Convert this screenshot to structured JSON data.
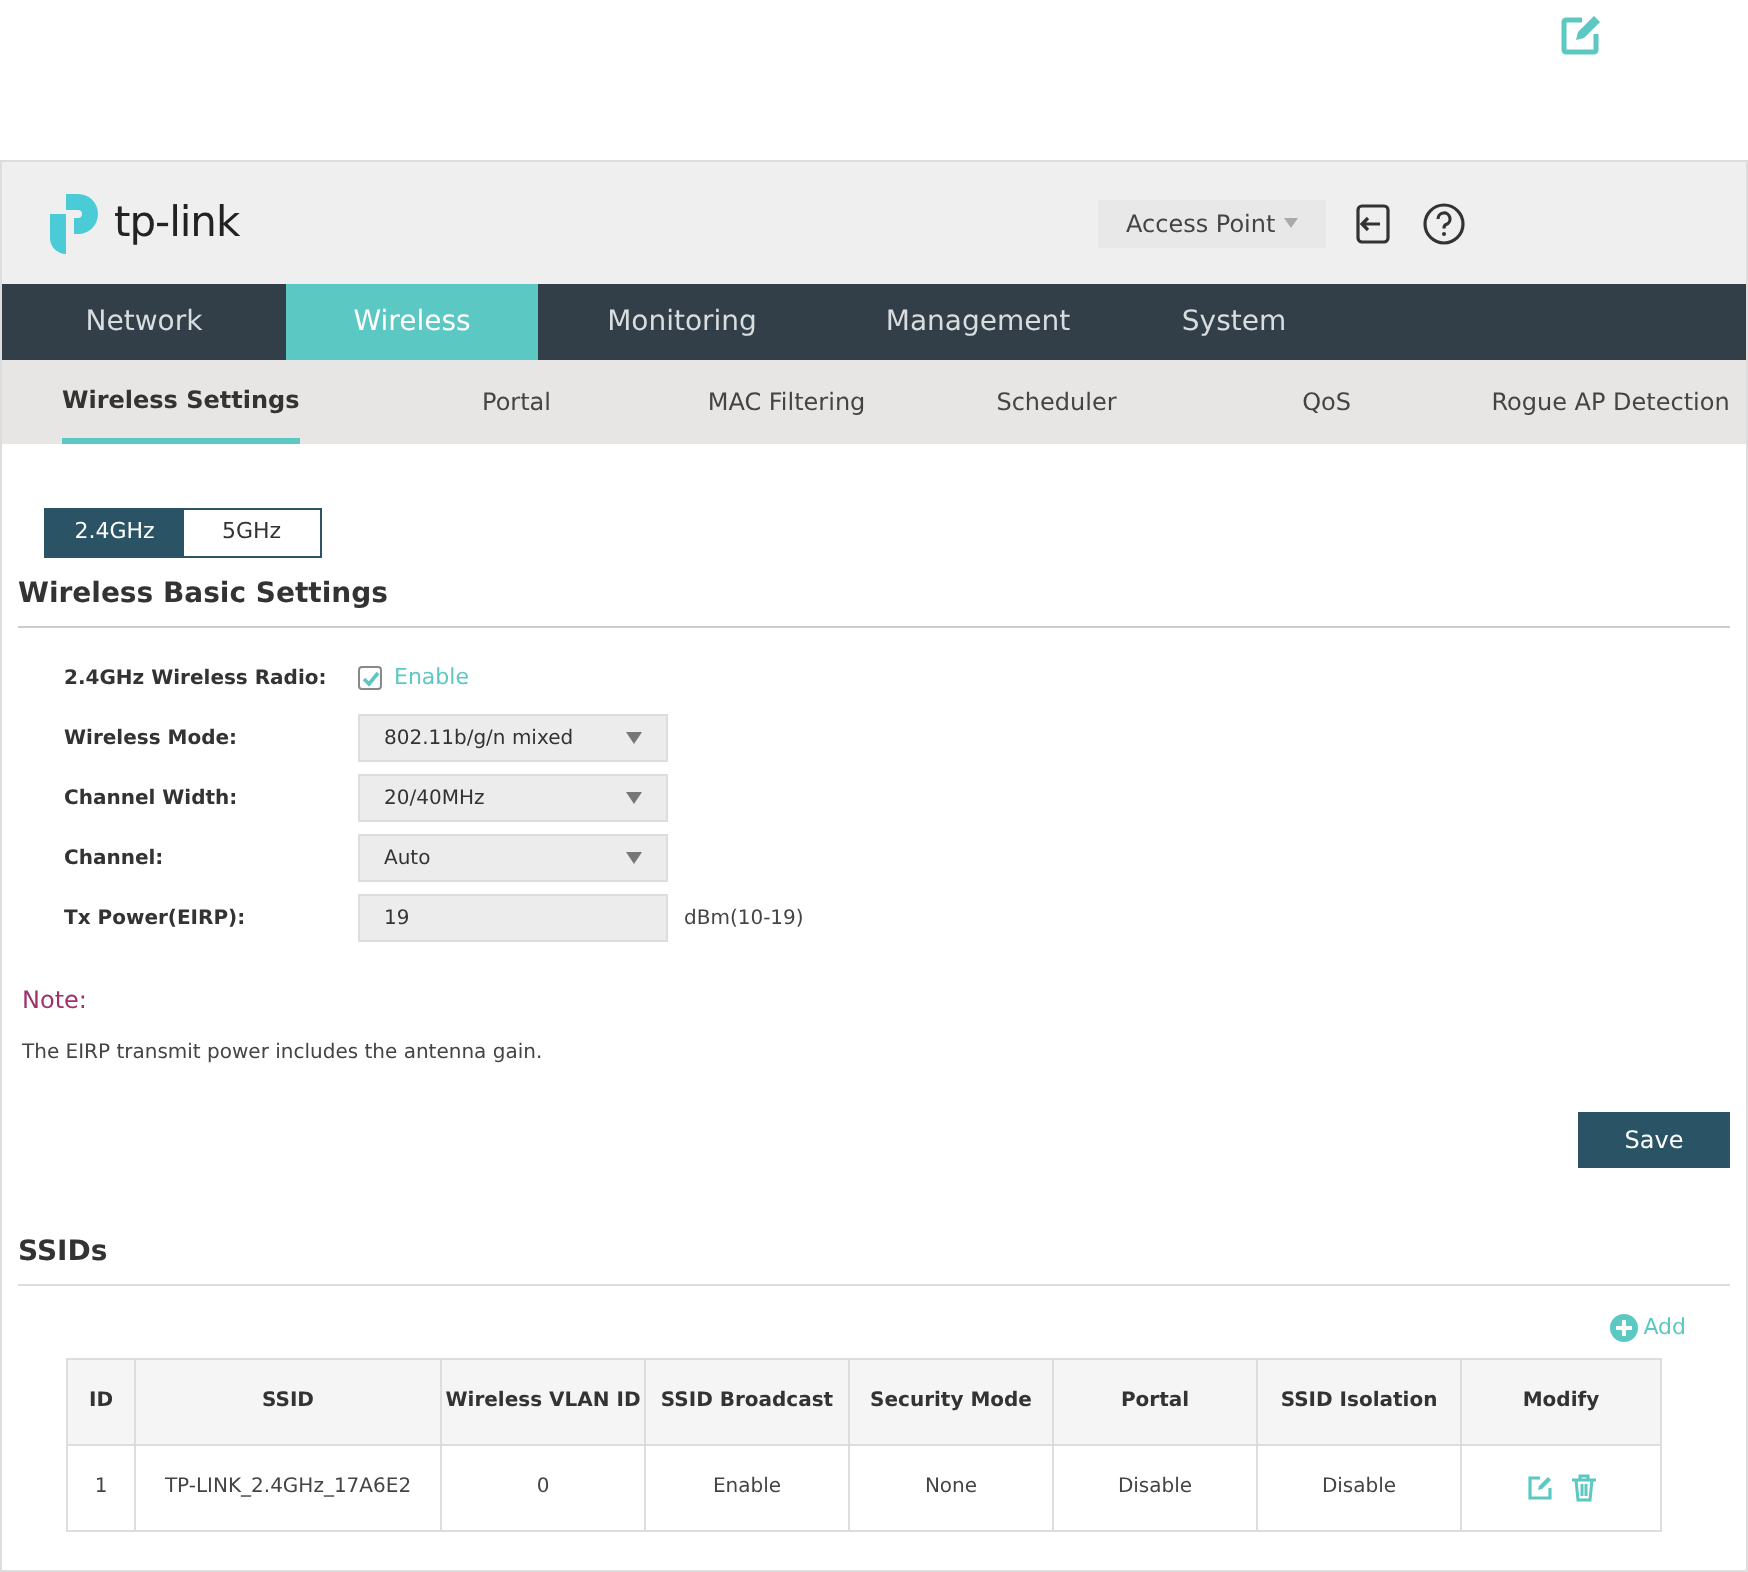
{
  "logo": {
    "text": "tp-link"
  },
  "mode_select": {
    "value": "Access Point"
  },
  "main_nav": [
    {
      "label": "Network",
      "selected": false
    },
    {
      "label": "Wireless",
      "selected": true
    },
    {
      "label": "Monitoring",
      "selected": false
    },
    {
      "label": "Management",
      "selected": false
    },
    {
      "label": "System",
      "selected": false
    }
  ],
  "sub_nav": [
    {
      "label": "Wireless Settings",
      "selected": true
    },
    {
      "label": "Portal",
      "selected": false
    },
    {
      "label": "MAC Filtering",
      "selected": false
    },
    {
      "label": "Scheduler",
      "selected": false
    },
    {
      "label": "QoS",
      "selected": false
    },
    {
      "label": "Rogue AP Detection",
      "selected": false
    }
  ],
  "band_tabs": [
    {
      "label": "2.4GHz",
      "selected": true
    },
    {
      "label": "5GHz",
      "selected": false
    }
  ],
  "basic_settings": {
    "title": "Wireless Basic Settings",
    "fields": [
      {
        "kind": "checkbox",
        "label": "2.4GHz Wireless Radio:",
        "option": "Enable",
        "checked": true
      },
      {
        "kind": "select",
        "label": "Wireless Mode:",
        "value": "802.11b/g/n mixed"
      },
      {
        "kind": "select",
        "label": "Channel Width:",
        "value": "20/40MHz"
      },
      {
        "kind": "select",
        "label": "Channel:",
        "value": "Auto"
      },
      {
        "kind": "input",
        "label": "Tx Power(EIRP):",
        "value": "19",
        "unit": "dBm(10-19)"
      }
    ],
    "note_title": "Note:",
    "note": "The EIRP transmit power includes the antenna gain.",
    "save": "Save"
  },
  "ssids": {
    "title": "SSIDs",
    "add": "Add",
    "columns": [
      "ID",
      "SSID",
      "Wireless VLAN ID",
      "SSID Broadcast",
      "Security Mode",
      "Portal",
      "SSID Isolation",
      "Modify"
    ],
    "rows": [
      [
        "1",
        "TP-LINK_2.4GHz_17A6E2",
        "0",
        "Enable",
        "None",
        "Disable",
        "Disable"
      ]
    ]
  }
}
